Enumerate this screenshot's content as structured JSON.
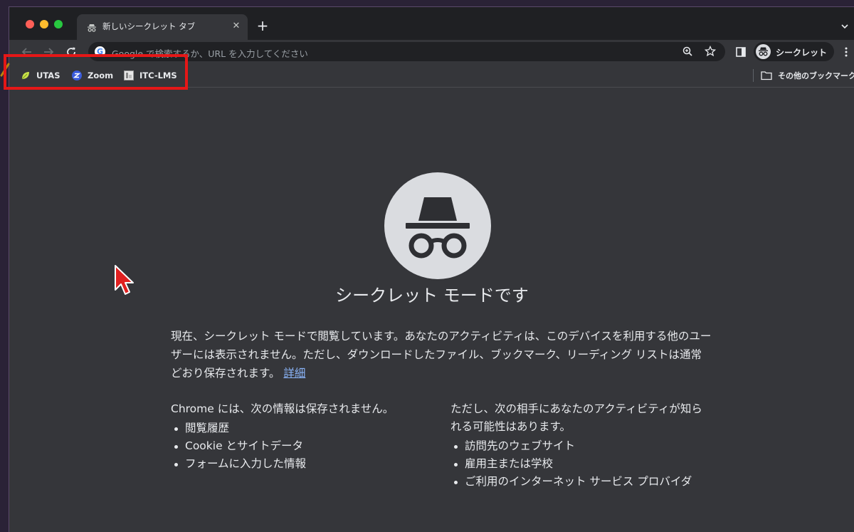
{
  "tab": {
    "title": "新しいシークレット タブ",
    "close_glyph": "✕",
    "new_tab_glyph": "+"
  },
  "omnibox": {
    "placeholder": "Google で検索するか、URL を入力してください",
    "logo": "G"
  },
  "profile": {
    "label": "シークレット"
  },
  "bookmarks": {
    "items": [
      {
        "label": "UTAS",
        "icon": "leaf-icon"
      },
      {
        "label": "Zoom",
        "icon": "zoom-icon"
      },
      {
        "label": "ITC-LMS",
        "icon": "lms-icon"
      }
    ],
    "other": "その他のブックマーク"
  },
  "incognito": {
    "heading": "シークレット モードです",
    "intro": "現在、シークレット モードで閲覧しています。あなたのアクティビティは、このデバイスを利用する他のユーザーには表示されません。ただし、ダウンロードしたファイル、ブックマーク、リーディング リストは通常どおり保存されます。",
    "learn_more": "詳細",
    "not_saved_title": "Chrome には、次の情報は保存されません。",
    "not_saved_items": [
      "閲覧履歴",
      "Cookie とサイトデータ",
      "フォームに入力した情報"
    ],
    "visible_title": "ただし、次の相手にあなたのアクティビティが知られる可能性はあります。",
    "visible_items": [
      "訪問先のウェブサイト",
      "雇用主または学校",
      "ご利用のインターネット サービス プロバイダ"
    ]
  },
  "colors": {
    "highlight_box": "#e51717",
    "page_background": "#35363a",
    "link": "#8ab4f8"
  }
}
